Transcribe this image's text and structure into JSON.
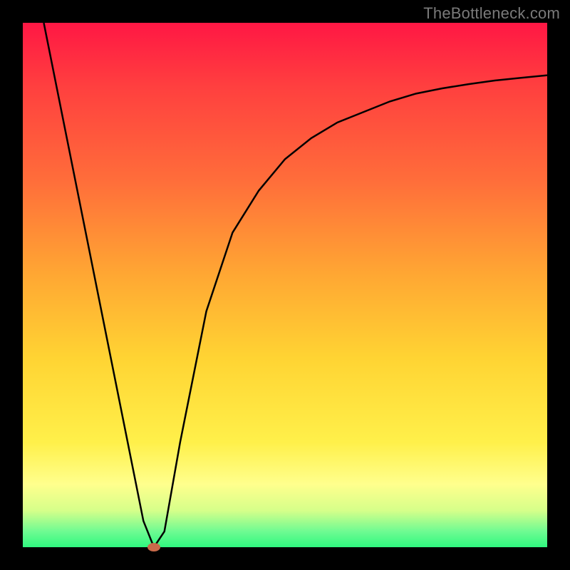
{
  "watermark": "TheBottleneck.com",
  "chart_data": {
    "type": "line",
    "title": "",
    "xlabel": "",
    "ylabel": "",
    "xlim": [
      0,
      100
    ],
    "ylim": [
      0,
      100
    ],
    "x": [
      4,
      8,
      12,
      16,
      20,
      23,
      25,
      27,
      30,
      35,
      40,
      45,
      50,
      55,
      60,
      65,
      70,
      75,
      80,
      85,
      90,
      95,
      100
    ],
    "y": [
      100,
      80,
      60,
      40,
      20,
      5,
      0,
      3,
      20,
      45,
      60,
      68,
      74,
      78,
      81,
      83,
      85,
      86.5,
      87.5,
      88.3,
      89,
      89.5,
      90
    ],
    "minimum_marker": {
      "x": 25,
      "y": 0
    },
    "note": "Axis ticks and numeric labels are not shown in the source image; values are estimates read from the curve shape (V-shaped dip near x≈25 then asymptotic rise)."
  },
  "colors": {
    "frame": "#000000",
    "gradient_top": "#ff1744",
    "gradient_mid1": "#ffa733",
    "gradient_mid2": "#ffff8d",
    "gradient_bottom": "#2ff87f",
    "marker": "#c96a4a",
    "watermark": "#7a7a7a"
  }
}
